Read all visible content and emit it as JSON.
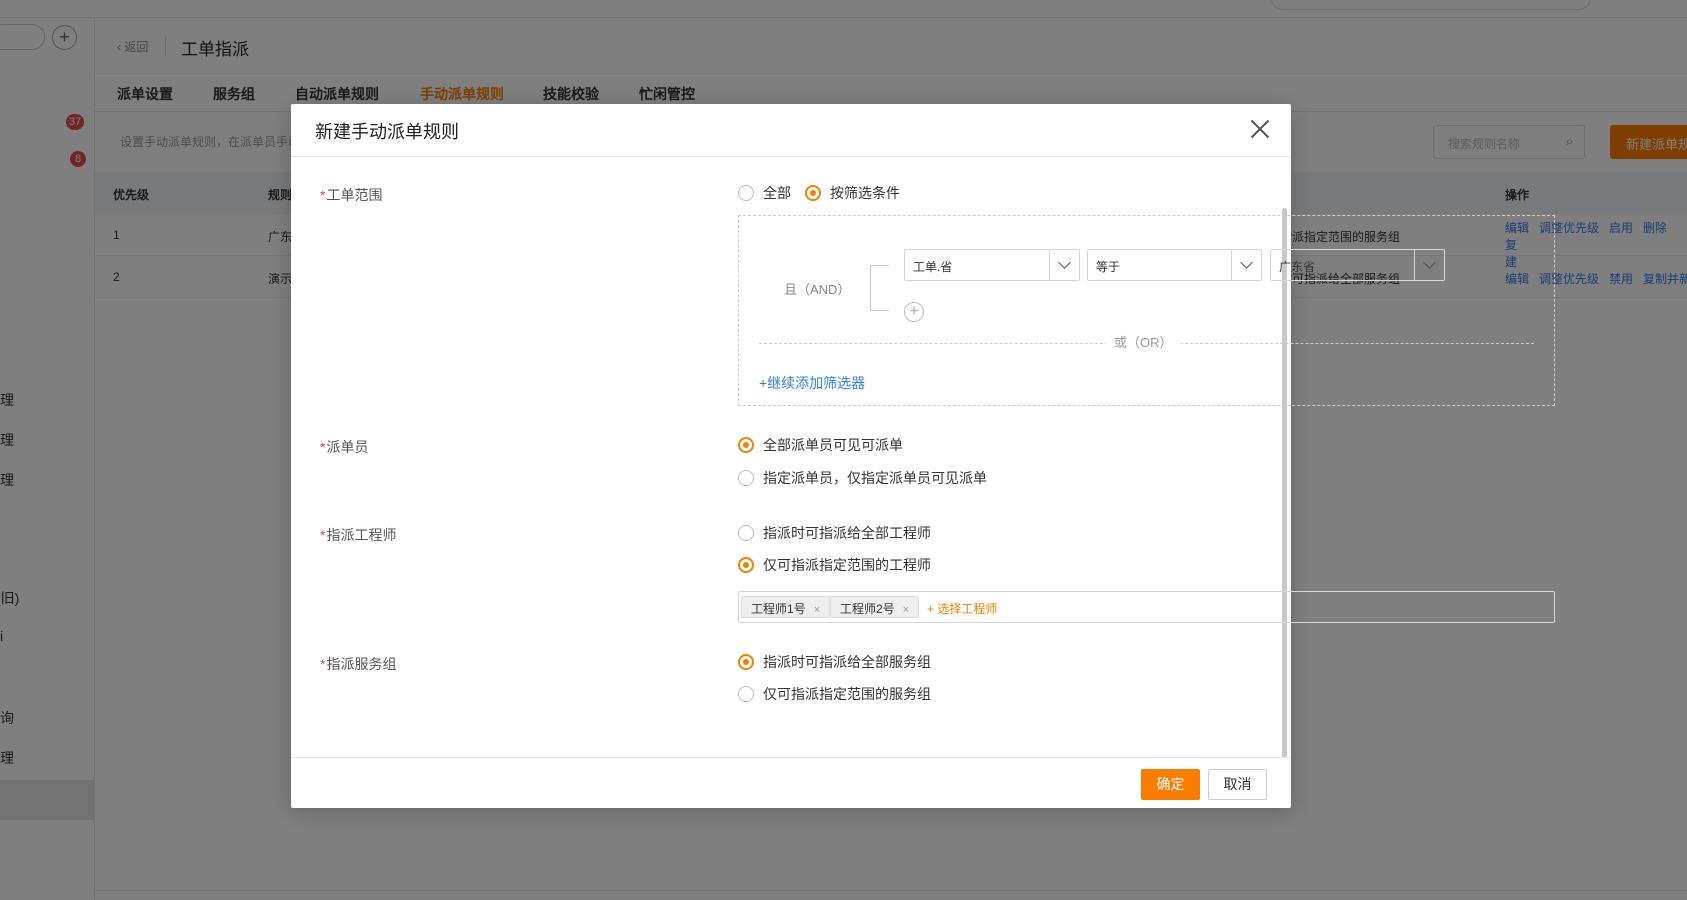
{
  "app": {
    "sidebar": {
      "badges": [
        "37",
        "8"
      ],
      "items": [
        "理",
        "管理",
        "管理",
        "(旧)",
        "i",
        "查询",
        "管理"
      ]
    },
    "header": {
      "back_label": "返回",
      "title": "工单指派"
    },
    "tabs": [
      "派单设置",
      "服务组",
      "自动派单规则",
      "手动派单规则",
      "技能校验",
      "忙闲管控"
    ],
    "active_tab": "手动派单规则",
    "description": "设置手动派单规则，在派单员手动",
    "search_placeholder": "搜索规则名称",
    "new_button": "新建派单规",
    "table": {
      "columns": [
        "优先级",
        "规则",
        "操作"
      ],
      "rows": [
        {
          "priority": "1",
          "rule": "广东",
          "scope": "指派指定范围的服务组",
          "ops": [
            "编辑",
            "调整优先级",
            "启用",
            "删除",
            "复"
          ],
          "ops_wrap": "建"
        },
        {
          "priority": "2",
          "rule": "演示",
          "scope": "时可指派给全部服务组",
          "ops": [
            "编辑",
            "调整优先级",
            "禁用",
            "复制并新"
          ]
        }
      ]
    }
  },
  "modal": {
    "title": "新建手动派单规则",
    "scope": {
      "label": "工单范围",
      "options": [
        "全部",
        "按筛选条件"
      ],
      "selected": "按筛选条件",
      "filter": {
        "and_label": "且（AND）",
        "field": "工单.省",
        "operator": "等于",
        "value": "广东省",
        "or_label": "或（OR）",
        "add_filter": "+继续添加筛选器"
      }
    },
    "dispatcher": {
      "label": "派单员",
      "options": [
        "全部派单员可见可派单",
        "指定派单员，仅指定派单员可见派单"
      ],
      "selected": "全部派单员可见可派单"
    },
    "engineer": {
      "label": "指派工程师",
      "options": [
        "指派时可指派给全部工程师",
        "仅可指派指定范围的工程师"
      ],
      "selected": "仅可指派指定范围的工程师",
      "tags": [
        "工程师1号",
        "工程师2号"
      ],
      "pick_label": "+ 选择工程师"
    },
    "service_group": {
      "label": "指派服务组",
      "options": [
        "指派时可指派给全部服务组",
        "仅可指派指定范围的服务组"
      ],
      "selected": "指派时可指派给全部服务组"
    },
    "ok_label": "确定",
    "cancel_label": "取消"
  },
  "colors": {
    "accent": "#fa7d00",
    "link": "#2f80ed",
    "required": "#e5484d"
  }
}
